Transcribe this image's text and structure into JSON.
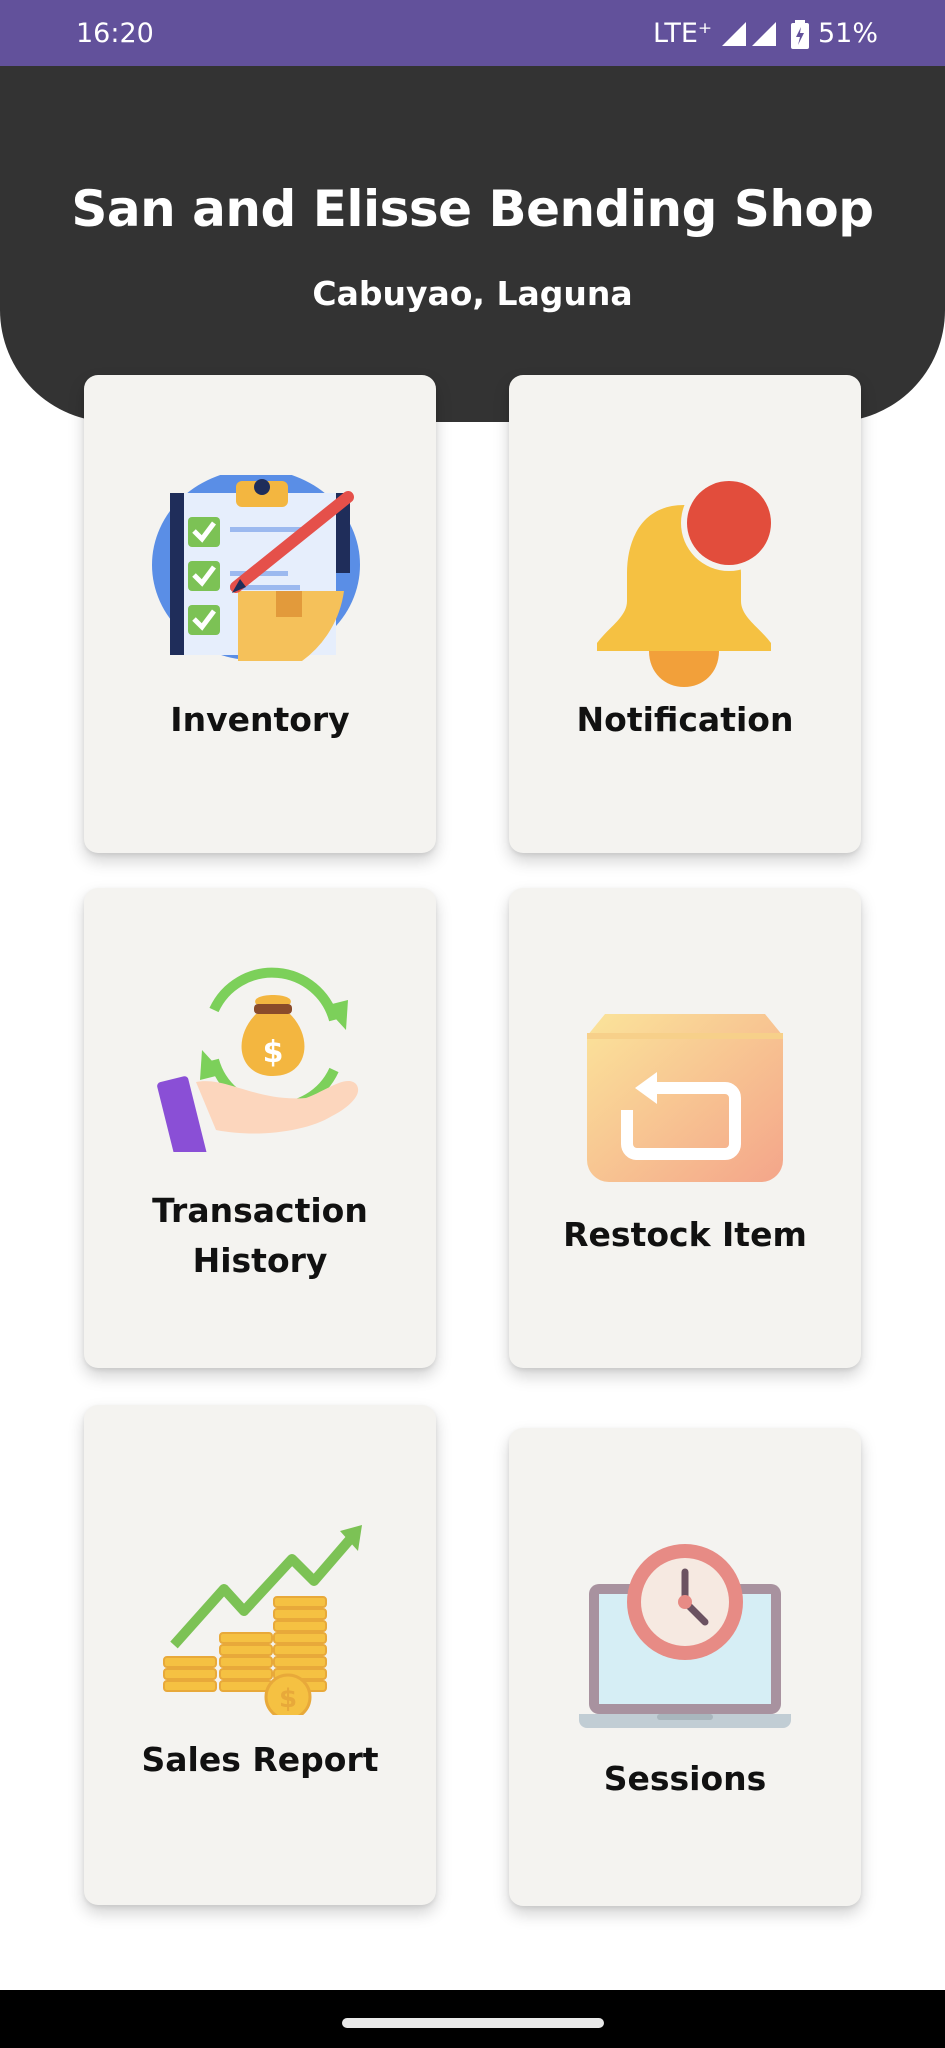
{
  "status_bar": {
    "time": "16:20",
    "network": "LTE⁺",
    "battery": "51%",
    "background": "#62519b"
  },
  "header": {
    "title": "San and Elisse Bending Shop",
    "subtitle": "Cabuyao, Laguna",
    "background": "#333333"
  },
  "menu": [
    {
      "label": "Inventory",
      "icon": "clipboard-checklist-icon"
    },
    {
      "label": "Notification",
      "icon": "bell-icon"
    },
    {
      "label": "Transaction History",
      "icon": "money-bag-hand-icon"
    },
    {
      "label": "Restock Item",
      "icon": "box-return-icon"
    },
    {
      "label": "Sales Report",
      "icon": "coins-growth-chart-icon"
    },
    {
      "label": "Sessions",
      "icon": "laptop-clock-icon"
    }
  ]
}
